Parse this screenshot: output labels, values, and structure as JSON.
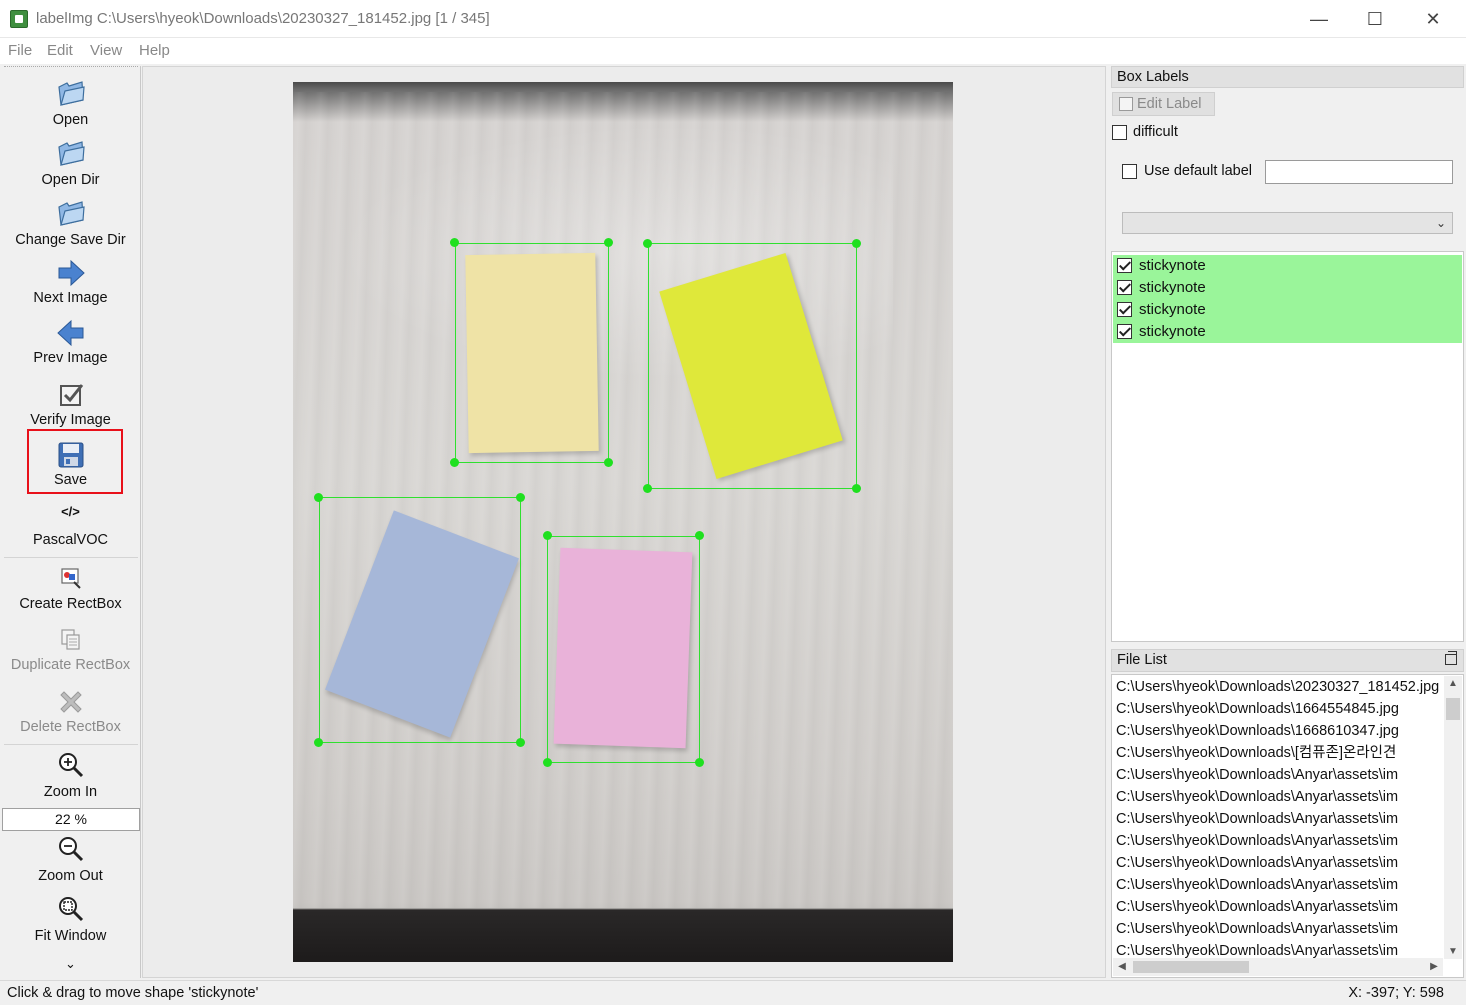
{
  "window": {
    "title": "labelImg C:\\Users\\hyeok\\Downloads\\20230327_181452.jpg [1 / 345]",
    "minimize": "—",
    "maximize": "☐",
    "close": "✕"
  },
  "menu": [
    "File",
    "Edit",
    "View",
    "Help"
  ],
  "toolbar": {
    "open": "Open",
    "open_dir": "Open Dir",
    "change_save_dir": "Change Save Dir",
    "next_image": "Next Image",
    "prev_image": "Prev Image",
    "verify_image": "Verify Image",
    "save": "Save",
    "format_icon_text": "</>",
    "format": "PascalVOC",
    "create_rectbox": "Create RectBox",
    "duplicate_rectbox": "Duplicate RectBox",
    "delete_rectbox": "Delete RectBox",
    "zoom_in": "Zoom In",
    "zoom_level": "22 %",
    "zoom_out": "Zoom Out",
    "fit_window": "Fit Window",
    "more": "⌄"
  },
  "box_labels": {
    "title": "Box Labels",
    "edit_label": "Edit Label",
    "difficult": "difficult",
    "difficult_checked": false,
    "use_default_label": "Use default label",
    "use_default_label_checked": false,
    "default_label_value": "",
    "labels": [
      {
        "name": "stickynote",
        "checked": true
      },
      {
        "name": "stickynote",
        "checked": true
      },
      {
        "name": "stickynote",
        "checked": true
      },
      {
        "name": "stickynote",
        "checked": true
      }
    ],
    "highlight_color": "#9af59a"
  },
  "file_list": {
    "title": "File List",
    "files": [
      "C:\\Users\\hyeok\\Downloads\\20230327_181452.jpg",
      "C:\\Users\\hyeok\\Downloads\\1664554845.jpg",
      "C:\\Users\\hyeok\\Downloads\\1668610347.jpg",
      "C:\\Users\\hyeok\\Downloads\\[컴퓨존]온라인견",
      "C:\\Users\\hyeok\\Downloads\\Anyar\\assets\\im",
      "C:\\Users\\hyeok\\Downloads\\Anyar\\assets\\im",
      "C:\\Users\\hyeok\\Downloads\\Anyar\\assets\\im",
      "C:\\Users\\hyeok\\Downloads\\Anyar\\assets\\im",
      "C:\\Users\\hyeok\\Downloads\\Anyar\\assets\\im",
      "C:\\Users\\hyeok\\Downloads\\Anyar\\assets\\im",
      "C:\\Users\\hyeok\\Downloads\\Anyar\\assets\\im",
      "C:\\Users\\hyeok\\Downloads\\Anyar\\assets\\im",
      "C:\\Users\\hyeok\\Downloads\\Anyar\\assets\\im"
    ]
  },
  "canvas": {
    "note_colors": {
      "yellow": "#efe3a6",
      "lime": "#dfe83a",
      "blue": "#a6b7d8",
      "pink": "#e9b2d9"
    },
    "bbox_color": "#2fe02f",
    "highlight_box_color": "#e8101a"
  },
  "status": {
    "message": "Click & drag to move shape 'stickynote'",
    "coords": "X: -397; Y: 598"
  }
}
